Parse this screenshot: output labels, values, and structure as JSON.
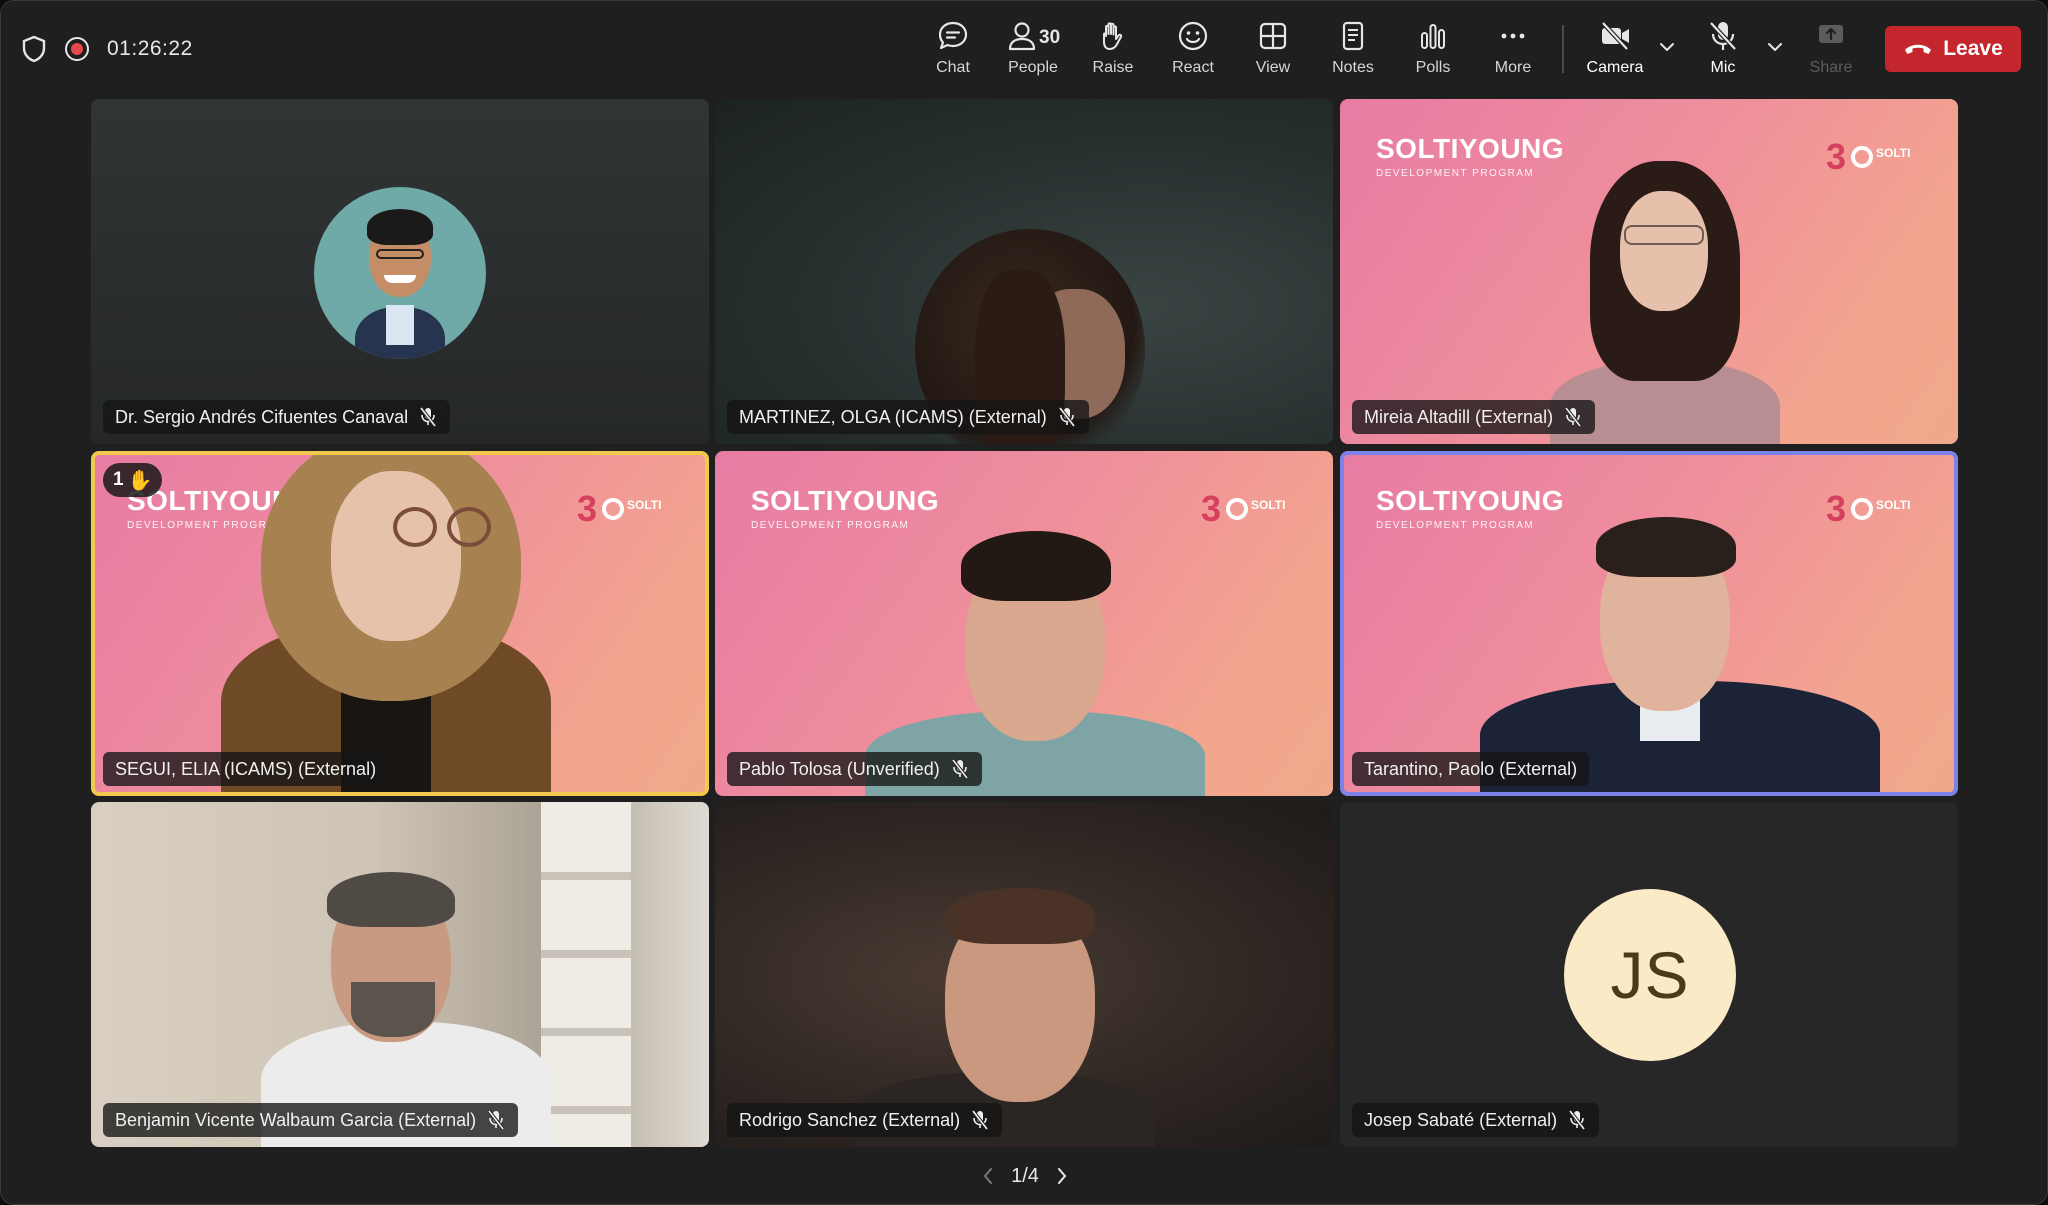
{
  "meeting": {
    "timer": "01:26:22"
  },
  "toolbar": {
    "chat": "Chat",
    "people": "People",
    "people_count": "30",
    "raise": "Raise",
    "react": "React",
    "view": "View",
    "notes": "Notes",
    "polls": "Polls",
    "more": "More",
    "camera": "Camera",
    "mic": "Mic",
    "share": "Share",
    "leave": "Leave"
  },
  "brand": {
    "name": "SOLTIYOUNG",
    "program": "DEVELOPMENT PROGRAM",
    "logo_text": "SOLTI"
  },
  "participants": [
    {
      "name": "Dr. Sergio Andrés Cifuentes Canaval"
    },
    {
      "name": "MARTINEZ, OLGA (ICAMS) (External)"
    },
    {
      "name": "Mireia Altadill (External)"
    },
    {
      "name": "SEGUI, ELIA (ICAMS) (External)",
      "hand_count": "1"
    },
    {
      "name": "Pablo Tolosa (Unverified)"
    },
    {
      "name": "Tarantino, Paolo (External)"
    },
    {
      "name": "Benjamin Vicente Walbaum Garcia (External)"
    },
    {
      "name": "Rodrigo Sanchez (External)"
    },
    {
      "name": "Josep Sabaté (External)",
      "initials": "JS"
    }
  ],
  "pager": {
    "label": "1/4"
  },
  "colors": {
    "leave": "#c4262e",
    "hand_highlight": "#f2c94c",
    "speaking_highlight": "#7b83eb",
    "initials_bg": "#fbeac6"
  }
}
